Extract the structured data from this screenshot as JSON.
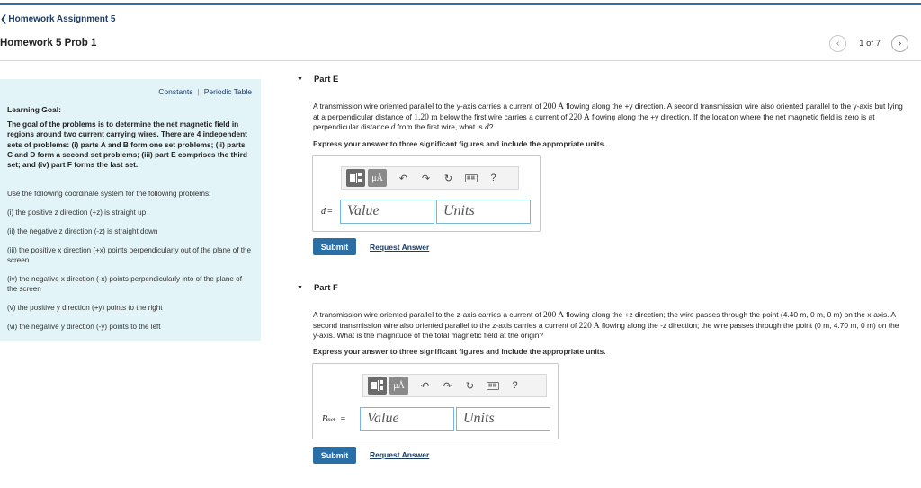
{
  "nav": {
    "back_label": "Homework Assignment 5",
    "problem_title": "Homework 5 Prob 1",
    "pager_text": "1 of 7"
  },
  "sidebar": {
    "constants_label": "Constants",
    "periodic_table_label": "Periodic Table",
    "learning_goal_title": "Learning Goal:",
    "learning_goal_text": "The goal of the problems is to determine the net magnetic field in regions around two current carrying wires. There are 4 independent sets of problems: (i) parts A and B form one set problems; (ii) parts C and D form a second set problems; (iii) part E comprises the third set; and (iv) part F forms the last set.",
    "paragraphs": [
      "Use the following coordinate system for the following problems:",
      "(i) the positive z direction (+z) is straight up",
      "(ii) the negative z direction (-z) is straight down",
      "(iii) the positive x direction (+x) points perpendicularly out of the plane of the screen",
      "(iv) the negative x direction (-x) points perpendicularly into of the plane of the screen",
      "(v) the positive y direction (+y) points to the right",
      "(vi) the negative y direction (-y) points to the left"
    ]
  },
  "partE": {
    "label": "Part E",
    "q1": "A transmission wire oriented parallel to the y-axis carries a current of ",
    "current1": "200 A",
    "q2": " flowing along the +y direction. A second transmission wire also oriented parallel to the y-axis but lying at a perpendicular distance of ",
    "distance": "1.20 m",
    "q3": " below the first wire carries a current of ",
    "current2": "220 A",
    "q4": " flowing along the +y direction. If the location where the net magnetic field is zero is at perpendicular distance ",
    "var1": "d",
    "q5": " from the first wire, what is ",
    "var2": "d",
    "q6": "?",
    "instruction": "Express your answer to three significant figures and include the appropriate units.",
    "variable": "d",
    "value_placeholder": "Value",
    "units_placeholder": "Units",
    "submit_label": "Submit",
    "request_label": "Request Answer"
  },
  "partF": {
    "label": "Part F",
    "q1": "A transmission wire oriented parallel to the z-axis carries a current of ",
    "current1": "200 A",
    "q2": " flowing along the +z direction; the wire passes through the point (4.40 m, 0 m, 0 m) on the x-axis. A second transmission wire also oriented parallel to the z-axis carries a current of ",
    "current2": "220 A",
    "q3": " flowing along the -z direction; the wire passes through the point (0 m, 4.70 m, 0 m) on the y-axis. What is the magnitude of the total magnetic field at the origin?",
    "instruction": "Express your answer to three significant figures and include the appropriate units.",
    "variable": "B",
    "variable_sub": "net",
    "value_placeholder": "Value",
    "units_placeholder": "Units",
    "submit_label": "Submit",
    "request_label": "Request Answer"
  },
  "toolbar": {
    "mu_label": "μÅ",
    "help_label": "?"
  },
  "colors": {
    "accent": "#2a6ea6",
    "sidebar_bg": "#e3f4f8",
    "link": "#1a3d66"
  }
}
